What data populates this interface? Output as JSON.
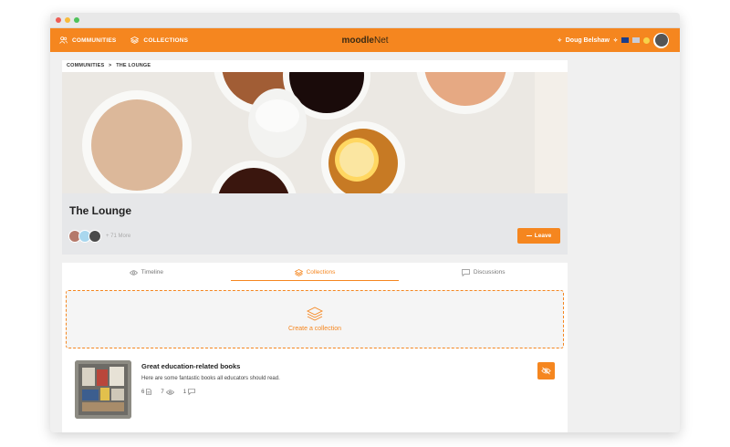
{
  "topbar": {
    "communities_label": "COMMUNITIES",
    "collections_label": "COLLECTIONS",
    "logo_main": "moodle",
    "logo_suffix": "Net",
    "user_name": "Doug Belshaw"
  },
  "breadcrumb": {
    "root": "COMMUNITIES",
    "separator": ">",
    "current": "THE LOUNGE"
  },
  "community": {
    "title": "The Lounge",
    "more_members": "+ 71 More",
    "leave_label": "Leave"
  },
  "tabs": [
    {
      "label": "Timeline",
      "icon": "eye-icon",
      "active": false
    },
    {
      "label": "Collections",
      "icon": "layers-icon",
      "active": true
    },
    {
      "label": "Discussions",
      "icon": "chat-icon",
      "active": false
    }
  ],
  "create_collection": {
    "label": "Create a collection"
  },
  "collections": [
    {
      "title": "Great education-related books",
      "description": "Here are some fantastic books all educators should read.",
      "resources": "6",
      "followers": "7",
      "comments": "1"
    }
  ],
  "colors": {
    "accent": "#f5861f",
    "background": "#f0f0f0"
  }
}
